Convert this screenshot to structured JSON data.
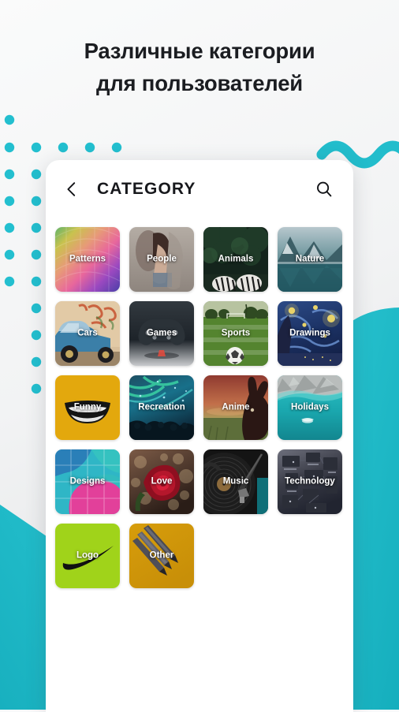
{
  "page": {
    "heading_line1": "Различные категории",
    "heading_line2": "для пользователей",
    "background_color": "#f8f9fa",
    "accent_color": "#22bdcc",
    "dot_color": "#23bfcf"
  },
  "appbar": {
    "back_icon": "chevron-left-icon",
    "title": "CATEGORY",
    "search_icon": "search-icon"
  },
  "grid": {
    "tiles": [
      {
        "label": "Patterns",
        "art": "rainbow-gradient"
      },
      {
        "label": "People",
        "art": "portrait-photo"
      },
      {
        "label": "Animals",
        "art": "zebra-jungle-photo"
      },
      {
        "label": "Nature",
        "art": "mountain-lake-photo"
      },
      {
        "label": "Cars",
        "art": "blue-car-graffiti-photo"
      },
      {
        "label": "Games",
        "art": "gamepad-dark-photo"
      },
      {
        "label": "Sports",
        "art": "soccer-field-photo"
      },
      {
        "label": "Drawings",
        "art": "starry-night-painting"
      },
      {
        "label": "Funny",
        "art": "yellow-smile-graphic"
      },
      {
        "label": "Recreation",
        "art": "concert-lights-photo"
      },
      {
        "label": "Anime",
        "art": "rabbit-silhouette-photo"
      },
      {
        "label": "Holidays",
        "art": "turquoise-beach-photo"
      },
      {
        "label": "Designs",
        "art": "teal-pink-tiles-graphic"
      },
      {
        "label": "Love",
        "art": "red-rose-bokeh-photo"
      },
      {
        "label": "Music",
        "art": "vinyl-record-photo"
      },
      {
        "label": "Technology",
        "art": "circuit-board-photo"
      },
      {
        "label": "Logo",
        "art": "green-swoosh-graphic"
      },
      {
        "label": "Other",
        "art": "pencils-gold-photo"
      }
    ]
  }
}
